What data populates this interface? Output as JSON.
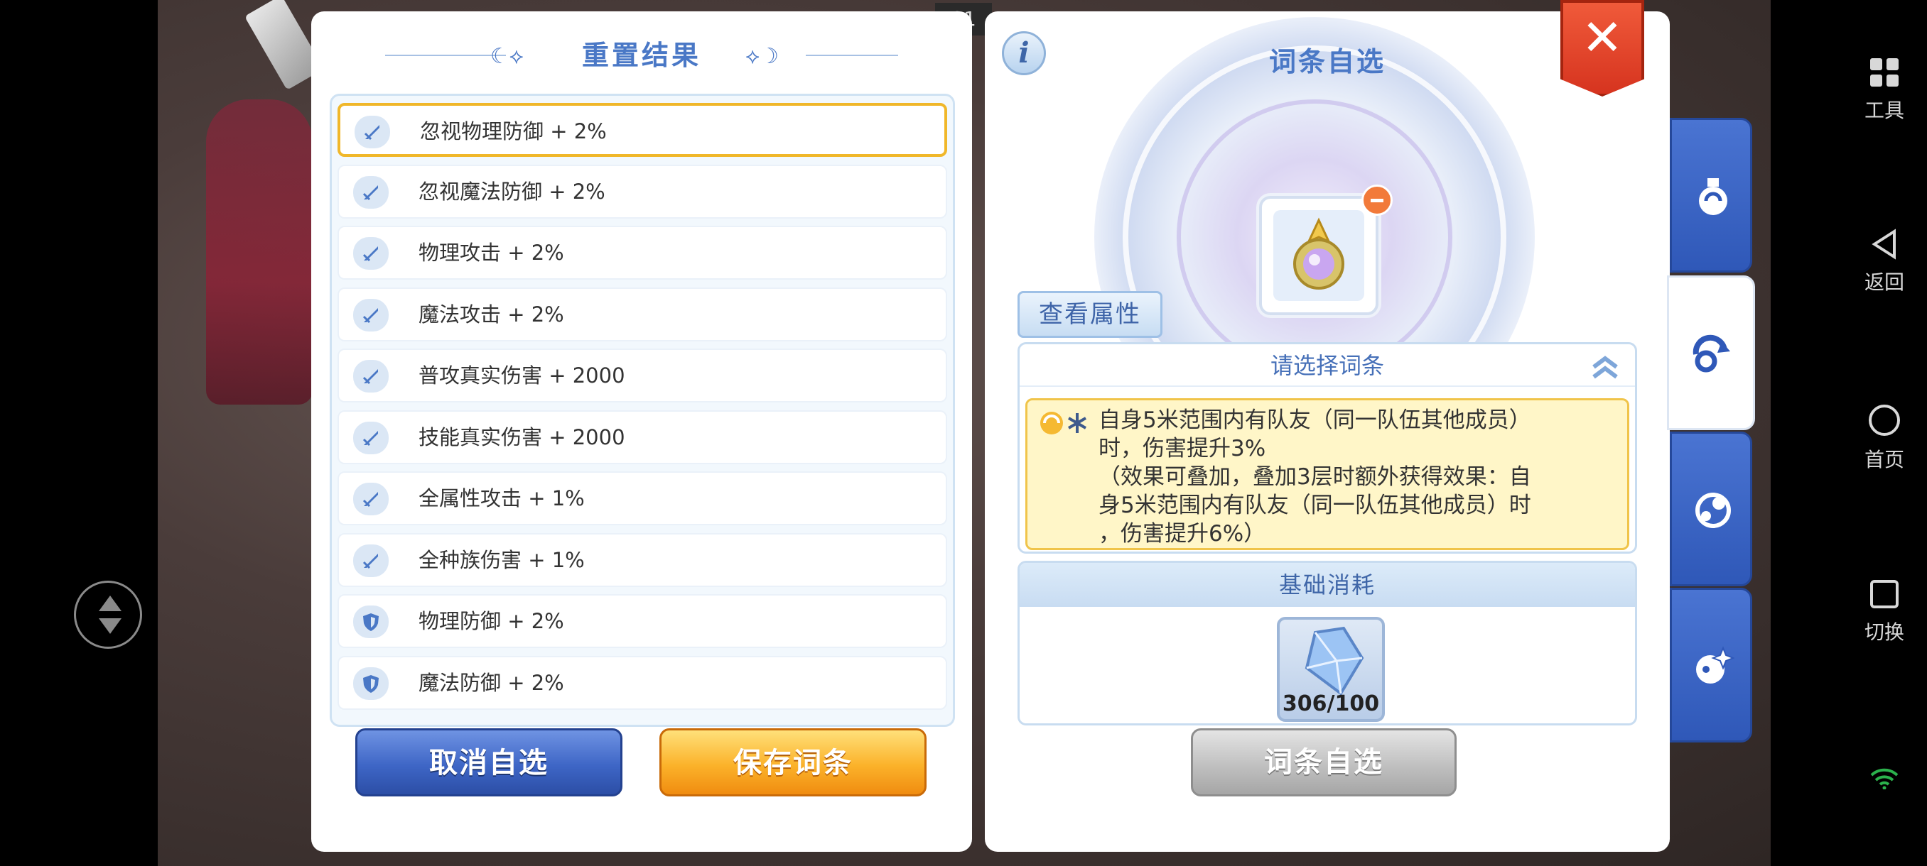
{
  "page_index": "01",
  "left_panel": {
    "title": "重置结果",
    "attributes": [
      {
        "label": "忽视物理防御 + 2%",
        "icon": "sword-icon",
        "selected": true
      },
      {
        "label": "忽视魔法防御 + 2%",
        "icon": "sword-icon",
        "selected": false
      },
      {
        "label": "物理攻击 + 2%",
        "icon": "sword-icon",
        "selected": false
      },
      {
        "label": "魔法攻击 + 2%",
        "icon": "sword-icon",
        "selected": false
      },
      {
        "label": "普攻真实伤害 + 2000",
        "icon": "sword-icon",
        "selected": false
      },
      {
        "label": "技能真实伤害 + 2000",
        "icon": "sword-icon",
        "selected": false
      },
      {
        "label": "全属性攻击 + 1%",
        "icon": "sword-icon",
        "selected": false
      },
      {
        "label": "全种族伤害 + 1%",
        "icon": "sword-icon",
        "selected": false
      },
      {
        "label": "物理防御 + 2%",
        "icon": "shield-icon",
        "selected": false
      },
      {
        "label": "魔法防御 + 2%",
        "icon": "shield-icon",
        "selected": false
      }
    ],
    "cancel_label": "取消自选",
    "save_label": "保存词条"
  },
  "right_panel": {
    "info_label": "i",
    "title": "词条自选",
    "view_attr_label": "查看属性",
    "select_header": "请选择词条",
    "description": "自身5米范围内有队友（同一队伍其他成员）\n时，伤害提升3%\n（效果可叠加，叠加3层时额外获得效果：自\n身5米范围内有队友（同一队伍其他成员）时\n，伤害提升6%）",
    "cost_header": "基础消耗",
    "cost_count": "306/100",
    "affix_button_label": "词条自选",
    "close_label": "✕"
  },
  "side_tabs": [
    "potion-icon",
    "refresh-icon",
    "orbit-icon",
    "sparkle-icon"
  ],
  "system_bar": {
    "tools_label": "工具",
    "back_label": "返回",
    "home_label": "首页",
    "switch_label": "切换"
  },
  "colors": {
    "accent_blue": "#4a78c6",
    "selected_border": "#f0b72a",
    "save_orange": "#fbb22a",
    "cancel_blue": "#3e66c6",
    "close_red": "#d6341f"
  }
}
